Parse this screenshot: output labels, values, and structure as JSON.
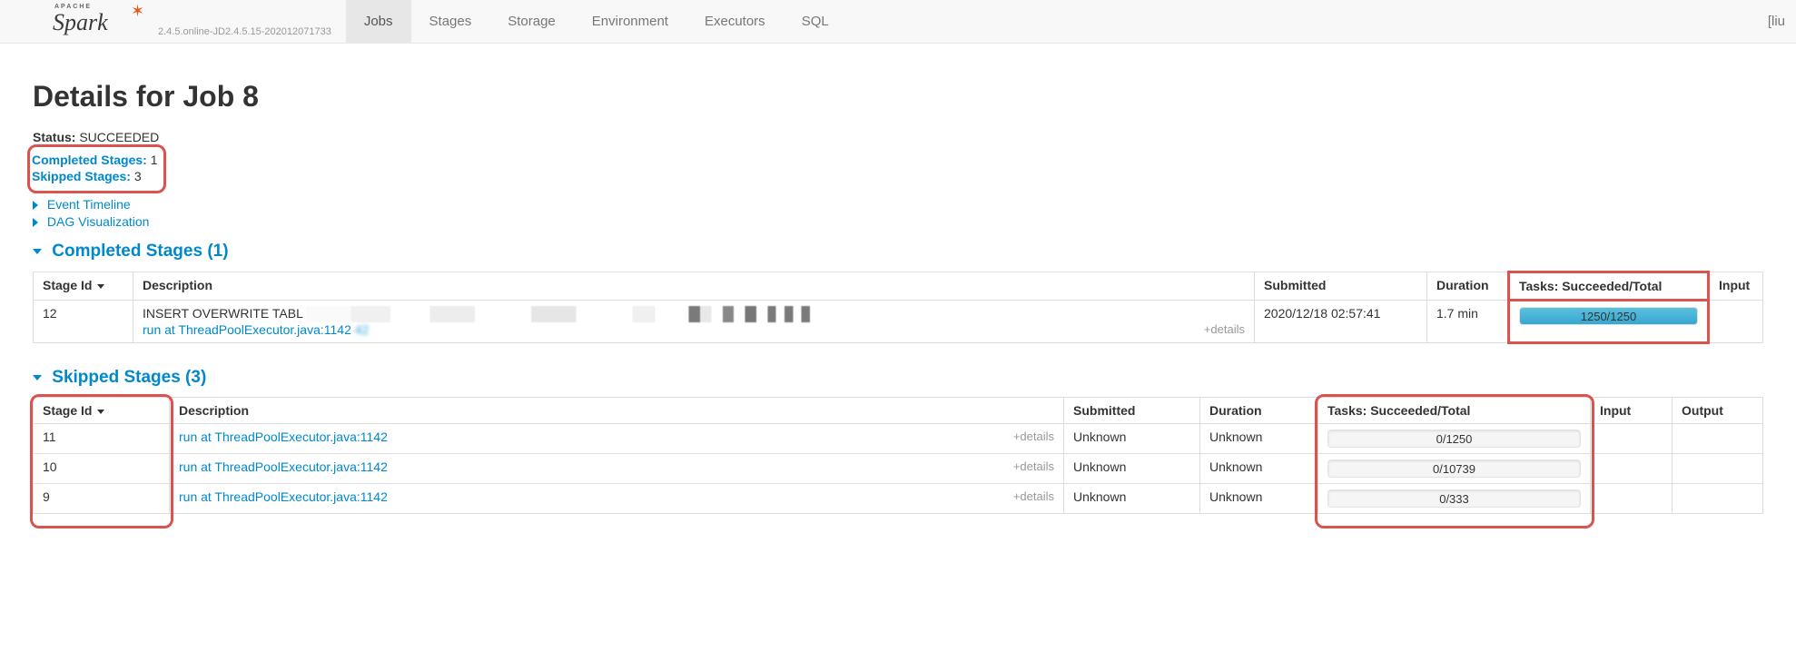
{
  "brand": {
    "apache": "APACHE",
    "name": "Spark",
    "version": "2.4.5.online-JD2.4.5.15-202012071733"
  },
  "nav": {
    "items": [
      {
        "label": "Jobs",
        "active": true
      },
      {
        "label": "Stages"
      },
      {
        "label": "Storage"
      },
      {
        "label": "Environment"
      },
      {
        "label": "Executors"
      },
      {
        "label": "SQL"
      }
    ],
    "right": "[liu"
  },
  "page": {
    "title": "Details for Job 8"
  },
  "summary": {
    "status_k": "Status:",
    "status_v": "SUCCEEDED",
    "completed_k": "Completed Stages:",
    "completed_v": "1",
    "skipped_k": "Skipped Stages:",
    "skipped_v": "3"
  },
  "toggles": {
    "event_timeline": "Event Timeline",
    "dag": "DAG Visualization",
    "completed_head": "Completed Stages (1)",
    "skipped_head": "Skipped Stages (3)"
  },
  "completed_table": {
    "headers": {
      "stage_id": "Stage Id",
      "description": "Description",
      "submitted": "Submitted",
      "duration": "Duration",
      "tasks": "Tasks: Succeeded/Total",
      "input": "Input"
    },
    "row": {
      "stage_id": "12",
      "desc_main": "INSERT OVERWRITE TABL",
      "desc_link": "run at ThreadPoolExecutor.java:1142",
      "details": "+details",
      "submitted": "2020/12/18 02:57:41",
      "duration": "1.7 min",
      "tasks_label": "1250/1250",
      "tasks_pct": 100
    }
  },
  "skipped_table": {
    "headers": {
      "stage_id": "Stage Id",
      "description": "Description",
      "submitted": "Submitted",
      "duration": "Duration",
      "tasks": "Tasks: Succeeded/Total",
      "input": "Input",
      "output": "Output"
    },
    "rows": [
      {
        "stage_id": "11",
        "desc_link": "run at ThreadPoolExecutor.java:1142",
        "details": "+details",
        "submitted": "Unknown",
        "duration": "Unknown",
        "tasks_label": "0/1250",
        "tasks_pct": 0
      },
      {
        "stage_id": "10",
        "desc_link": "run at ThreadPoolExecutor.java:1142",
        "details": "+details",
        "submitted": "Unknown",
        "duration": "Unknown",
        "tasks_label": "0/10739",
        "tasks_pct": 0
      },
      {
        "stage_id": "9",
        "desc_link": "run at ThreadPoolExecutor.java:1142",
        "details": "+details",
        "submitted": "Unknown",
        "duration": "Unknown",
        "tasks_label": "0/333",
        "tasks_pct": 0
      }
    ]
  }
}
